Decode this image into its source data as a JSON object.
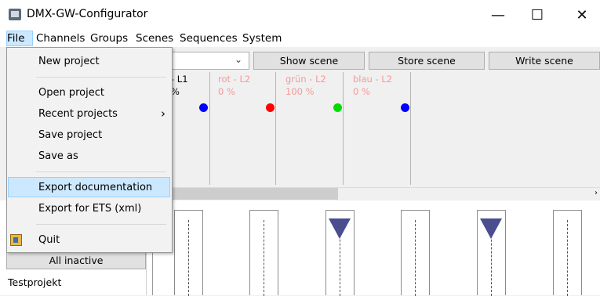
{
  "window": {
    "title": "DMX-GW-Configurator",
    "minimize": "—",
    "maximize": "☐",
    "close": "✕"
  },
  "menubar": {
    "items": [
      "File",
      "Channels",
      "Groups",
      "Scenes",
      "Sequences",
      "System"
    ]
  },
  "toolbar": {
    "combo_value": "",
    "show_scene": "Show scene",
    "store_scene": "Store scene",
    "write_scene": "Write scene"
  },
  "channels": [
    {
      "label": "- L1",
      "value": "%",
      "color": "#0000ff"
    },
    {
      "label": "rot - L2",
      "value": "0 %",
      "color": "#ff0000"
    },
    {
      "label": "grün - L2",
      "value": "100 %",
      "color": "#00dd00"
    },
    {
      "label": "blau - L2",
      "value": "0 %",
      "color": "#0000ff"
    }
  ],
  "file_menu": {
    "new_project": "New project",
    "open_project": "Open project",
    "recent_projects": "Recent projects",
    "recent_arrow": "›",
    "save_project": "Save project",
    "save_as": "Save as",
    "export_documentation": "Export documentation",
    "export_ets": "Export for ETS (xml)",
    "quit": "Quit"
  },
  "sidebar": {
    "all_inactive": "All inactive",
    "project_name": "Testprojekt"
  },
  "icons": {
    "app": "app-icon",
    "quit": "exit-door-icon",
    "fader_knob": "triangle-down-icon"
  },
  "colors": {
    "highlight": "#cce8ff",
    "channel_label": "#f39a9a",
    "fader_knob": "#4a4e8f"
  }
}
